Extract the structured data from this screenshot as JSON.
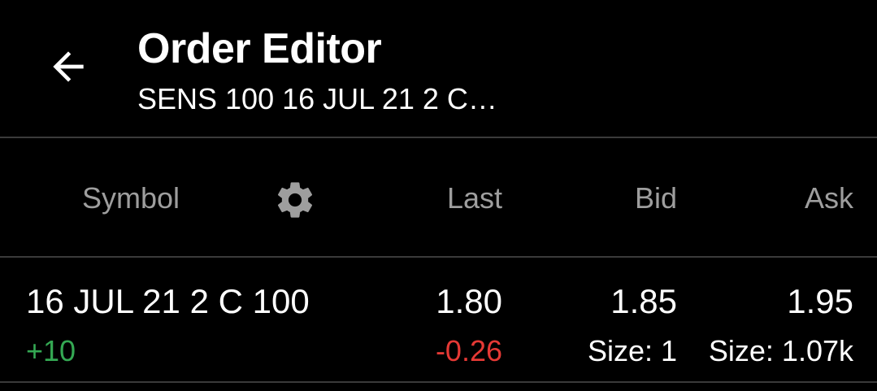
{
  "header": {
    "title": "Order Editor",
    "subtitle": "SENS 100 16 JUL 21 2 C…"
  },
  "columns": {
    "symbol": "Symbol",
    "last": "Last",
    "bid": "Bid",
    "ask": "Ask"
  },
  "icons": {
    "back": "arrow-left-icon",
    "settings": "gear-icon"
  },
  "rows": [
    {
      "symbol": "16 JUL 21 2 C 100",
      "position": "+10",
      "last": "1.80",
      "change": "-0.26",
      "bid": "1.85",
      "bid_size": "Size: 1",
      "ask": "1.95",
      "ask_size": "Size: 1.07k"
    }
  ],
  "colors": {
    "background": "#000000",
    "text": "#ffffff",
    "muted": "#9e9e9e",
    "positive": "#34a853",
    "negative": "#e53935",
    "divider": "#3a3a3a"
  }
}
